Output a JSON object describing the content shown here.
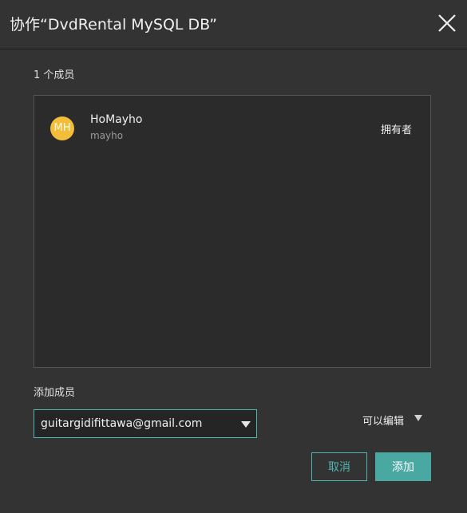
{
  "dialog": {
    "title": "协作“DvdRental MySQL DB”",
    "close_icon": "close-icon"
  },
  "members": {
    "count_label": "1 个成员",
    "items": [
      {
        "initials": "MH",
        "name": "HoMayho",
        "username": "mayho",
        "role": "拥有者",
        "avatar_color": "#f2be3a"
      }
    ]
  },
  "add_member": {
    "label": "添加成员",
    "email_value": "guitargidifittawa@gmail.com",
    "permission_value": "可以编辑",
    "dropdown_icon": "caret-down-icon"
  },
  "actions": {
    "cancel_label": "取消",
    "add_label": "添加"
  },
  "colors": {
    "background": "#333333",
    "accent": "#4aa8a3"
  }
}
